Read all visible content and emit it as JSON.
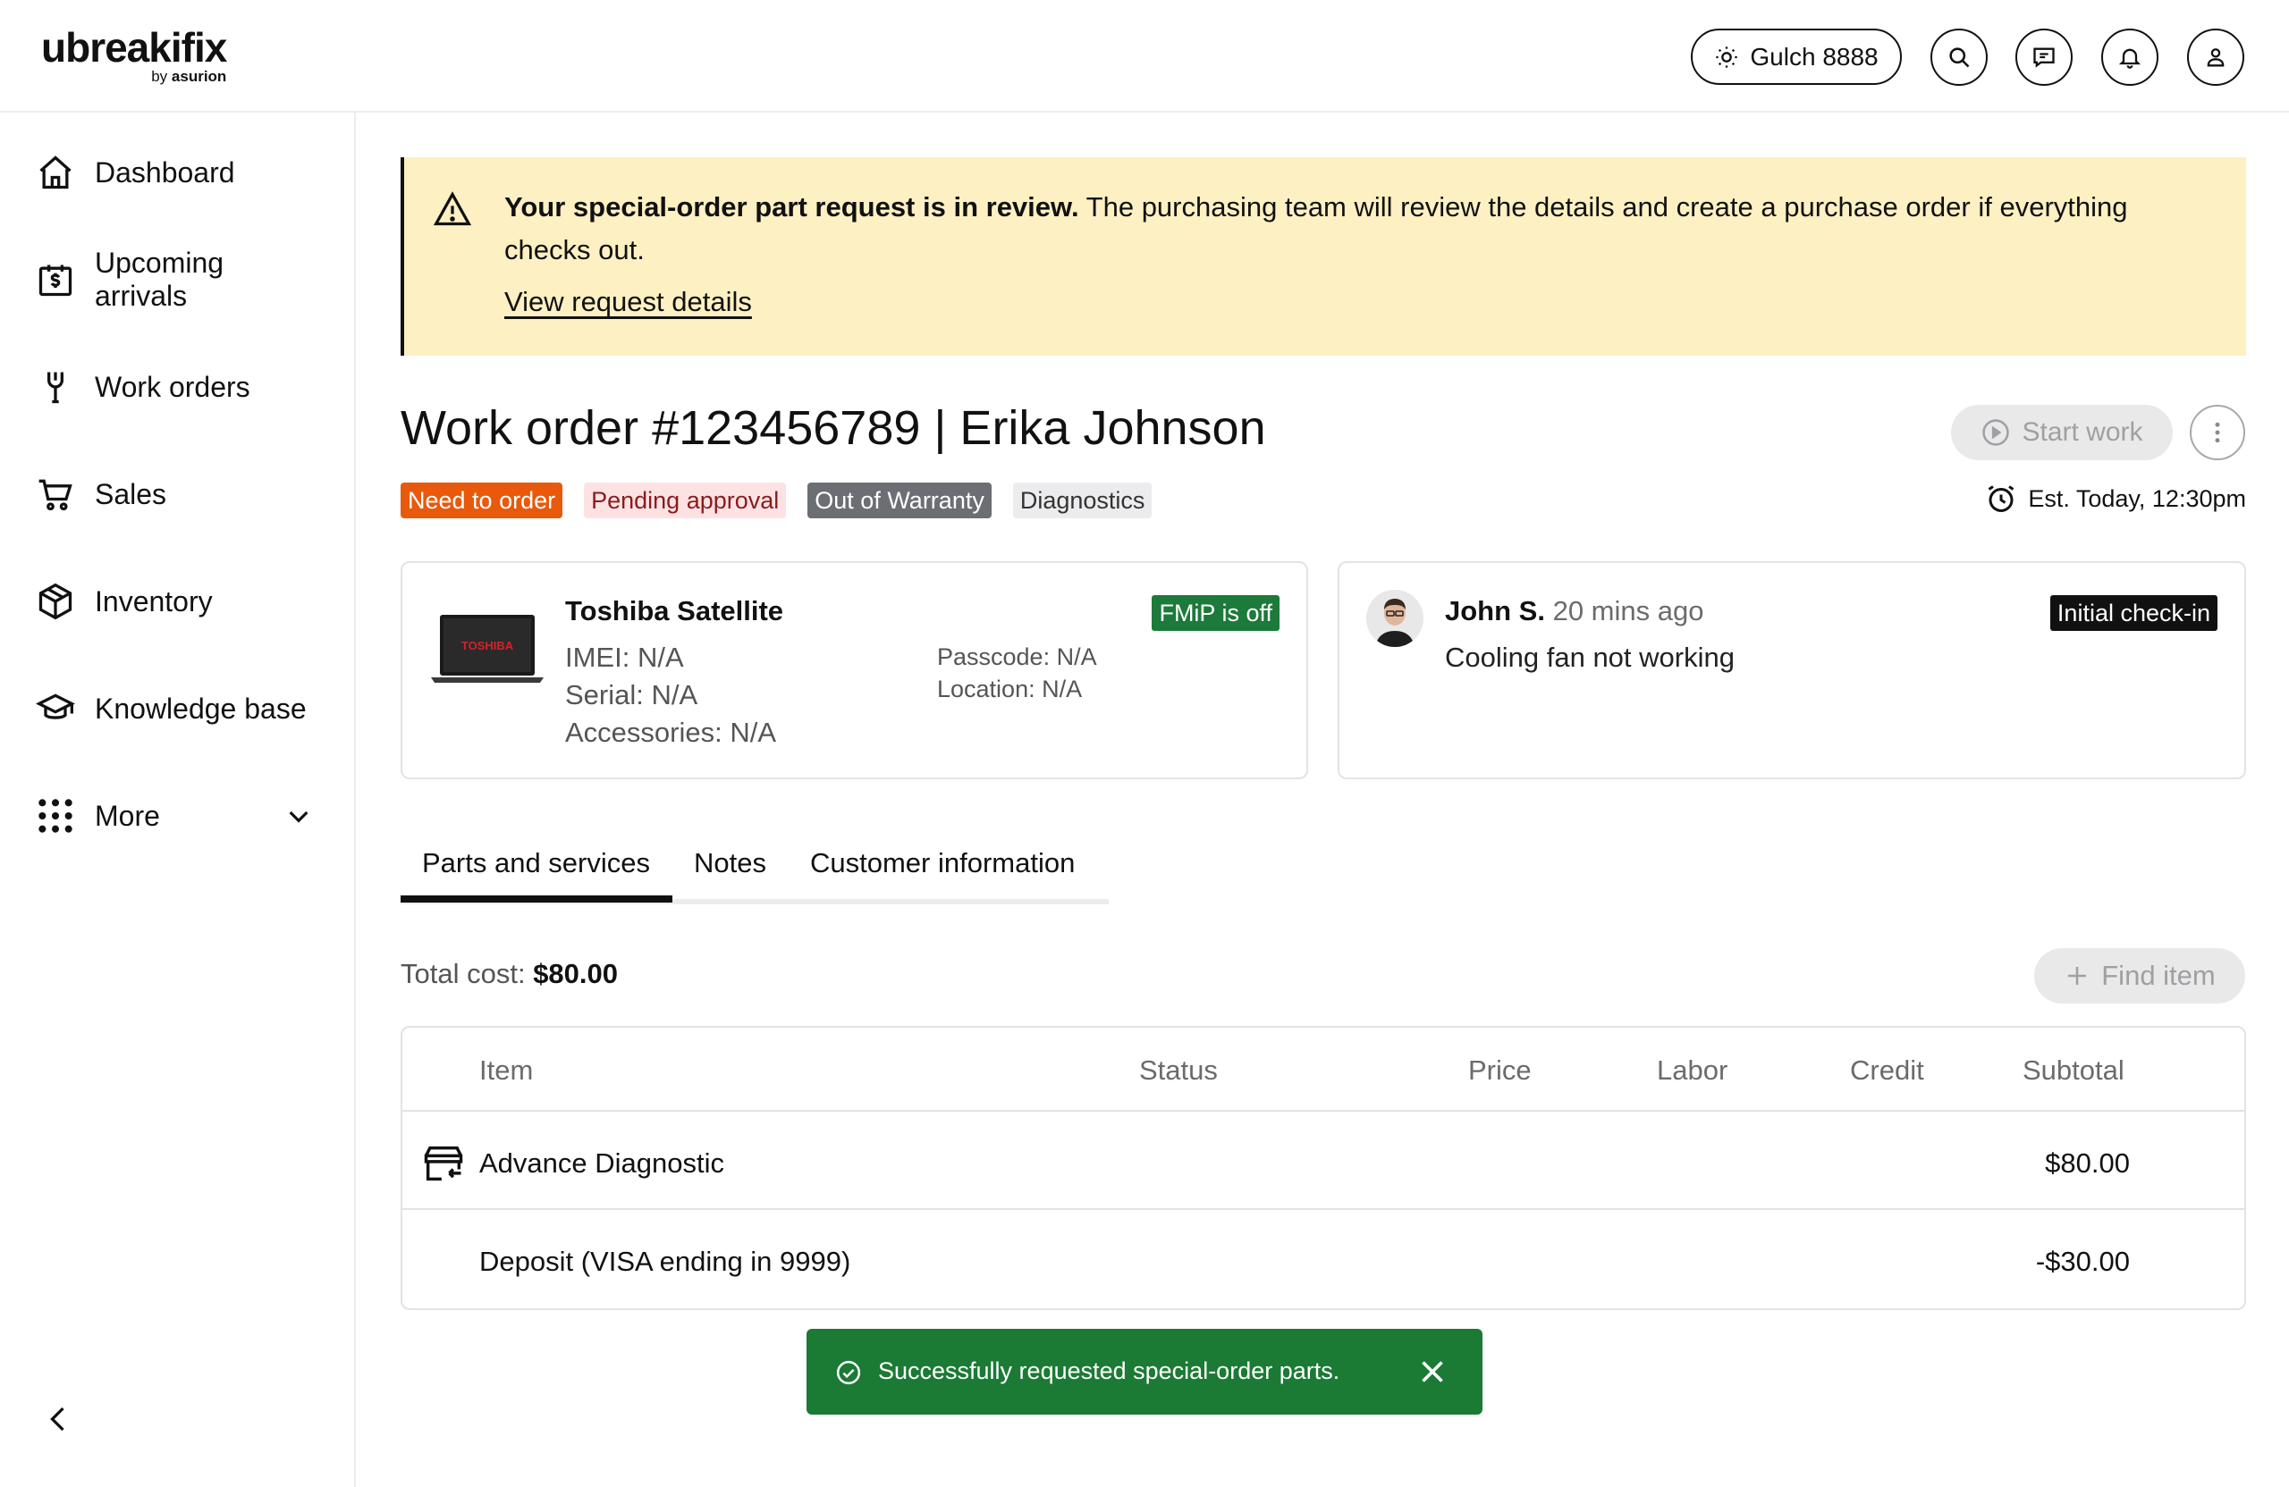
{
  "brand": {
    "logo_main": "ubreakifix",
    "logo_by": "by",
    "logo_sub": "asurion"
  },
  "header": {
    "store_label": "Gulch 8888",
    "icons": [
      "sun-icon",
      "search-icon",
      "chat-icon",
      "bell-icon",
      "user-icon"
    ]
  },
  "sidebar": {
    "items": [
      {
        "label": "Dashboard",
        "icon": "home-icon"
      },
      {
        "label": "Upcoming arrivals",
        "icon": "calendar-dollar-icon"
      },
      {
        "label": "Work orders",
        "icon": "wrench-icon"
      },
      {
        "label": "Sales",
        "icon": "cart-icon"
      },
      {
        "label": "Inventory",
        "icon": "box-icon"
      },
      {
        "label": "Knowledge base",
        "icon": "graduation-cap-icon"
      },
      {
        "label": "More",
        "icon": "grid-dots-icon"
      }
    ]
  },
  "banner": {
    "bold": "Your special-order part request is in review.",
    "text": " The purchasing team will review the details and create a purchase order if everything checks out.",
    "link": "View request details"
  },
  "work_order": {
    "title": "Work order #123456789 | Erika Johnson",
    "start_label": "Start work",
    "tags": [
      "Need to order",
      "Pending approval",
      "Out of Warranty",
      "Diagnostics"
    ],
    "estimate": "Est. Today, 12:30pm"
  },
  "device": {
    "logo_text": "TOSHIBA",
    "name": "Toshiba Satellite",
    "imei": "IMEI: N/A",
    "serial": "Serial: N/A",
    "accessories": "Accessories: N/A",
    "passcode": "Passcode: N/A",
    "location": "Location: N/A",
    "fmip": "FMiP is off"
  },
  "note": {
    "author": "John S.",
    "time": "20 mins ago",
    "text": "Cooling fan not working",
    "badge": "Initial check-in"
  },
  "tabs": [
    "Parts and services",
    "Notes",
    "Customer information"
  ],
  "total": {
    "label": "Total cost: ",
    "value": "$80.00"
  },
  "find_label": "Find item",
  "table": {
    "headers": [
      "Item",
      "Status",
      "Price",
      "Labor",
      "Credit",
      "Subtotal"
    ],
    "rows": [
      {
        "item": "Advance Diagnostic",
        "subtotal": "$80.00"
      },
      {
        "item": "Deposit (VISA ending in 9999)",
        "subtotal": "-$30.00"
      }
    ]
  },
  "toast": {
    "text": "Successfully requested special-order parts."
  },
  "colors": {
    "banner_bg": "#fdf0c2",
    "toast_bg": "#1b7a34",
    "tag_orange": "#e8590c",
    "fmip_green": "#1c7a3a"
  }
}
